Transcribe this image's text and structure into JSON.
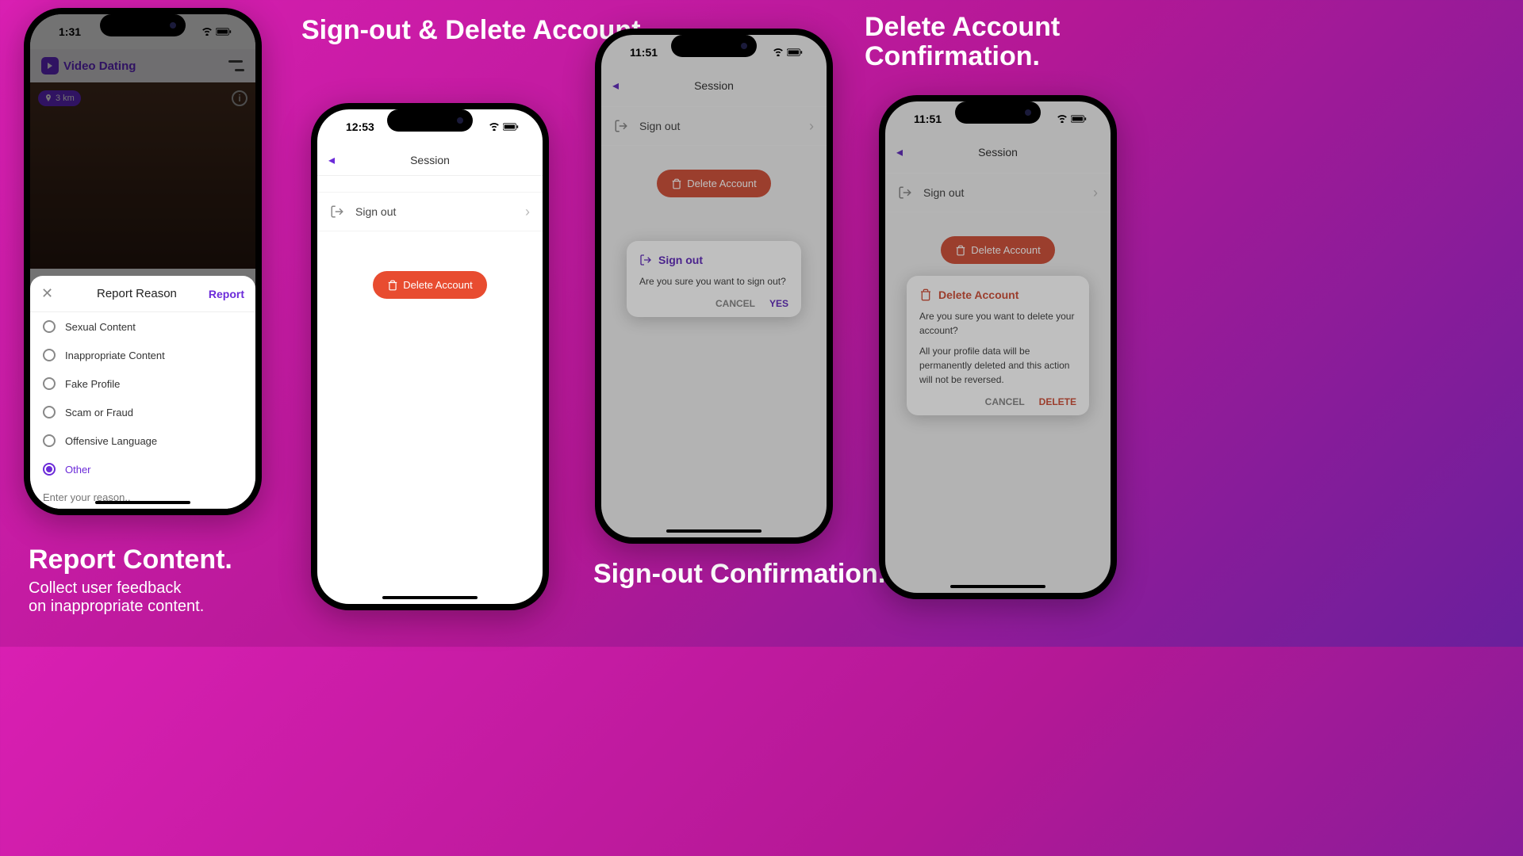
{
  "colors": {
    "accent": "#6c2bd9",
    "danger": "#e84c30"
  },
  "captions": {
    "signout_delete": "Sign-out & Delete Account.",
    "report_title": "Report Content.",
    "report_sub1": "Collect user feedback",
    "report_sub2": "on inappropriate content.",
    "signout_confirm": "Sign-out Confirmation.",
    "delete_confirm": "Delete Account Confirmation."
  },
  "phone1": {
    "time": "1:31",
    "app_title": "Video Dating",
    "distance": "3 km",
    "sheet_title": "Report Reason",
    "sheet_action": "Report",
    "reasons": [
      "Sexual Content",
      "Inappropriate Content",
      "Fake Profile",
      "Scam or Fraud",
      "Offensive Language",
      "Other"
    ],
    "selected_index": 5,
    "input_placeholder": "Enter your reason.."
  },
  "phone2": {
    "time": "12:53",
    "nav_title": "Session",
    "signout_label": "Sign out",
    "delete_label": "Delete Account"
  },
  "phone3": {
    "time": "11:51",
    "nav_title": "Session",
    "signout_label": "Sign out",
    "delete_label": "Delete Account",
    "dialog": {
      "title": "Sign out",
      "body": "Are you sure you want to sign out?",
      "cancel": "CANCEL",
      "confirm": "YES"
    }
  },
  "phone4": {
    "time": "11:51",
    "nav_title": "Session",
    "signout_label": "Sign out",
    "delete_label": "Delete Account",
    "dialog": {
      "title": "Delete Account",
      "body1": "Are you sure you want to delete your account?",
      "body2": "All your profile data will be permanently deleted and this action will not be reversed.",
      "cancel": "CANCEL",
      "confirm": "DELETE"
    }
  }
}
